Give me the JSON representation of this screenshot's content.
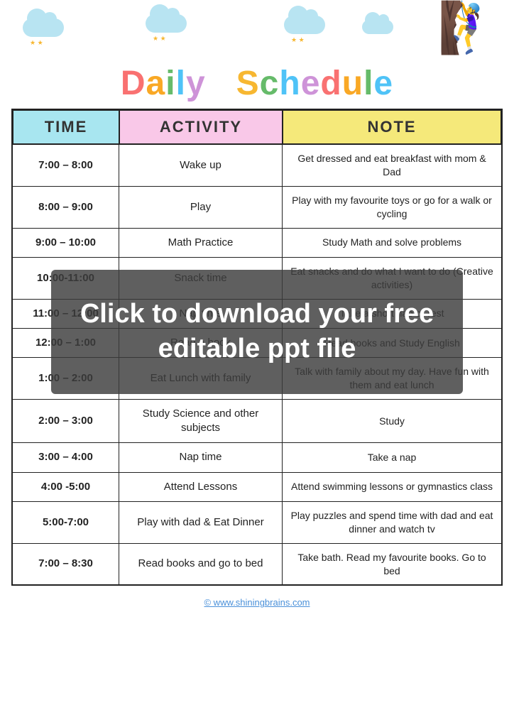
{
  "header": {
    "title_part1": "Daily ",
    "title_part2": "Schedule",
    "title_letters_daily": [
      "D",
      "a",
      "i",
      "l",
      "y"
    ],
    "title_letters_schedule": [
      "S",
      "c",
      "h",
      "e",
      "d",
      "u",
      "l",
      "e"
    ]
  },
  "table": {
    "headers": {
      "time": "TIME",
      "activity": "ACTIVITY",
      "note": "NOTE"
    },
    "rows": [
      {
        "time": "7:00 – 8:00",
        "activity": "Wake up",
        "note": "Get dressed and eat breakfast with mom & Dad"
      },
      {
        "time": "8:00 – 9:00",
        "activity": "Play",
        "note": "Play with my favourite toys or go for a walk or cycling"
      },
      {
        "time": "9:00 – 10:00",
        "activity": "Math Practice",
        "note": "Study Math and solve problems"
      },
      {
        "time": "10:00-11:00",
        "activity": "Snack time",
        "note": "Eat snacks and do what I want to do (Creative activities)"
      },
      {
        "time": "11:00 – 12:00",
        "activity": "Nap time",
        "note": "Take a short nap or rest"
      },
      {
        "time": "12:00 – 1:00",
        "activity": "Read a book",
        "note": "Read books and Study English"
      },
      {
        "time": "1:00 – 2:00",
        "activity": "Eat Lunch with family",
        "note": "Talk with family about my day. Have fun with them and eat lunch"
      },
      {
        "time": "2:00 – 3:00",
        "activity": "Study Science and other subjects",
        "note": "Study"
      },
      {
        "time": "3:00 – 4:00",
        "activity": "Nap time",
        "note": "Take a nap"
      },
      {
        "time": "4:00 -5:00",
        "activity": "Attend Lessons",
        "note": "Attend swimming lessons or gymnastics class"
      },
      {
        "time": "5:00-7:00",
        "activity": "Play with dad & Eat Dinner",
        "note": "Play puzzles and spend time with dad and eat dinner and watch tv"
      },
      {
        "time": "7:00 – 8:30",
        "activity": "Read books and go to bed",
        "note": "Take bath. Read my favourite books. Go to bed"
      }
    ]
  },
  "overlay": {
    "text": "Click to download your free editable ppt file"
  },
  "footer": {
    "website": "© www.shiningbrains.com"
  }
}
